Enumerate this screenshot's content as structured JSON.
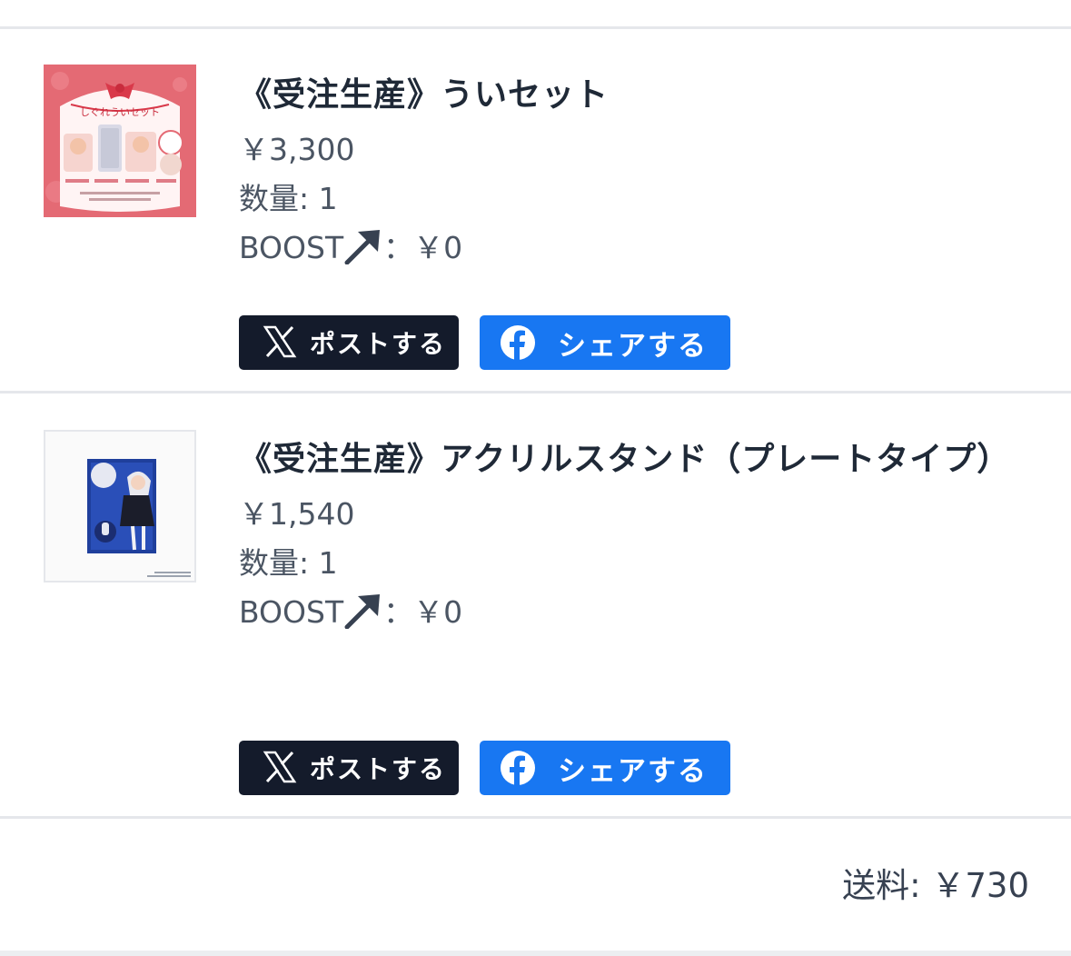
{
  "items": [
    {
      "title": "《受注生産》ういセット",
      "price": "￥3,300",
      "quantity_label": "数量:",
      "quantity": "1",
      "boost_label": "BOOST",
      "boost_value": "：￥0",
      "post_button": "ポストする",
      "share_button": "シェアする",
      "thumbnail": {
        "caption": "しぐれういセット"
      }
    },
    {
      "title": "《受注生産》アクリルスタンド（プレートタイプ）",
      "price": "￥1,540",
      "quantity_label": "数量:",
      "quantity": "1",
      "boost_label": "BOOST",
      "boost_value": "：￥0",
      "post_button": "ポストする",
      "share_button": "シェアする"
    }
  ],
  "shipping": {
    "label": "送料:",
    "value": "￥730"
  },
  "colors": {
    "x_button": "#141b2b",
    "facebook_button": "#1877f2",
    "divider": "#e5e7eb",
    "text_muted": "#4b5563"
  },
  "icons": {
    "x": "x-logo-icon",
    "facebook": "facebook-logo-icon",
    "boost": "boost-arrow-icon"
  }
}
